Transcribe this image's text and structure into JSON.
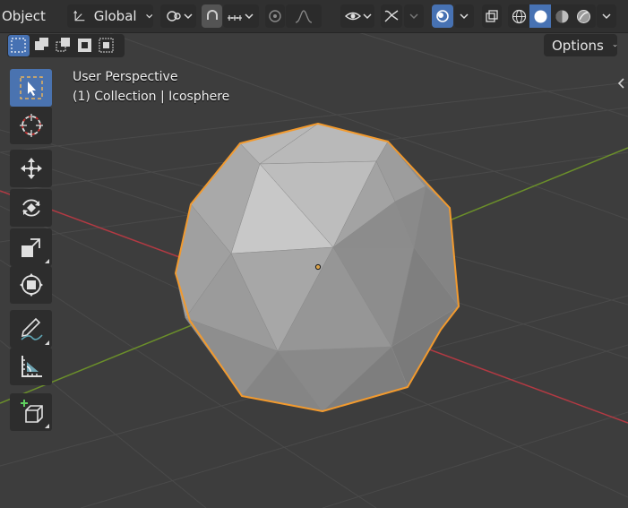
{
  "header": {
    "mode_label": "Object",
    "orientation_label": "Global",
    "options_label": "Options"
  },
  "overlay": {
    "view_name": "User Perspective",
    "collection_info": "(1) Collection | Icosphere"
  },
  "toolbar": {
    "tools": [
      "select-box",
      "cursor",
      "move",
      "rotate",
      "scale",
      "transform",
      "annotate",
      "measure",
      "add-cube"
    ],
    "active_tool": "select-box"
  },
  "colors": {
    "background": "#3d3d3d",
    "selection_outline": "#f29a2e",
    "x_axis": "#b23a43",
    "y_axis": "#6b8f2a",
    "active_button": "#4772b3"
  },
  "scene": {
    "object": "Icosphere",
    "shading": "solid"
  }
}
